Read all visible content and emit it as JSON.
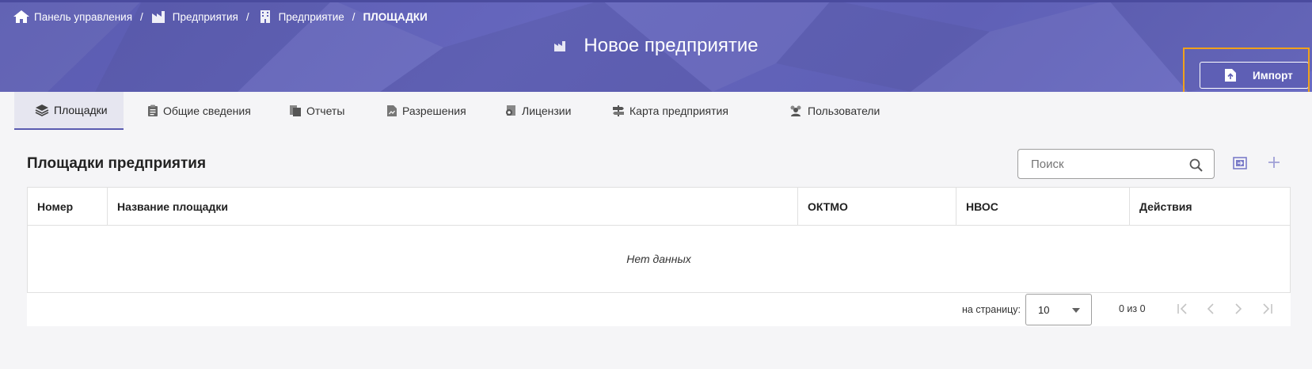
{
  "breadcrumbs": {
    "dashboard": "Панель управления",
    "enterprises": "Предприятия",
    "enterprise": "Предприятие",
    "current": "ПЛОЩАДКИ",
    "separator": "/"
  },
  "page": {
    "title": "Новое предприятие",
    "import_label": "Импорт"
  },
  "tabs": [
    {
      "label": "Площадки",
      "icon": "layers-icon",
      "active": true
    },
    {
      "label": "Общие сведения",
      "icon": "clipboard-icon",
      "active": false
    },
    {
      "label": "Отчеты",
      "icon": "documents-icon",
      "active": false
    },
    {
      "label": "Разрешения",
      "icon": "document-chart-icon",
      "active": false
    },
    {
      "label": "Лицензии",
      "icon": "license-icon",
      "active": false
    },
    {
      "label": "Карта предприятия",
      "icon": "signpost-icon",
      "active": false
    },
    {
      "label": "Пользователи",
      "icon": "users-icon",
      "active": false
    }
  ],
  "section": {
    "title": "Площадки предприятия",
    "search_placeholder": "Поиск"
  },
  "table": {
    "columns": [
      "Номер",
      "Название площадки",
      "ОКТМО",
      "НВОС",
      "Действия"
    ],
    "rows": [],
    "empty_text": "Нет данных"
  },
  "paginator": {
    "per_page_label": "на страницу:",
    "per_page_value": "10",
    "range_label": "0 из 0"
  },
  "colors": {
    "header": "#5f60b6",
    "accent": "#5a5bb0",
    "highlight": "#f0a11b"
  }
}
